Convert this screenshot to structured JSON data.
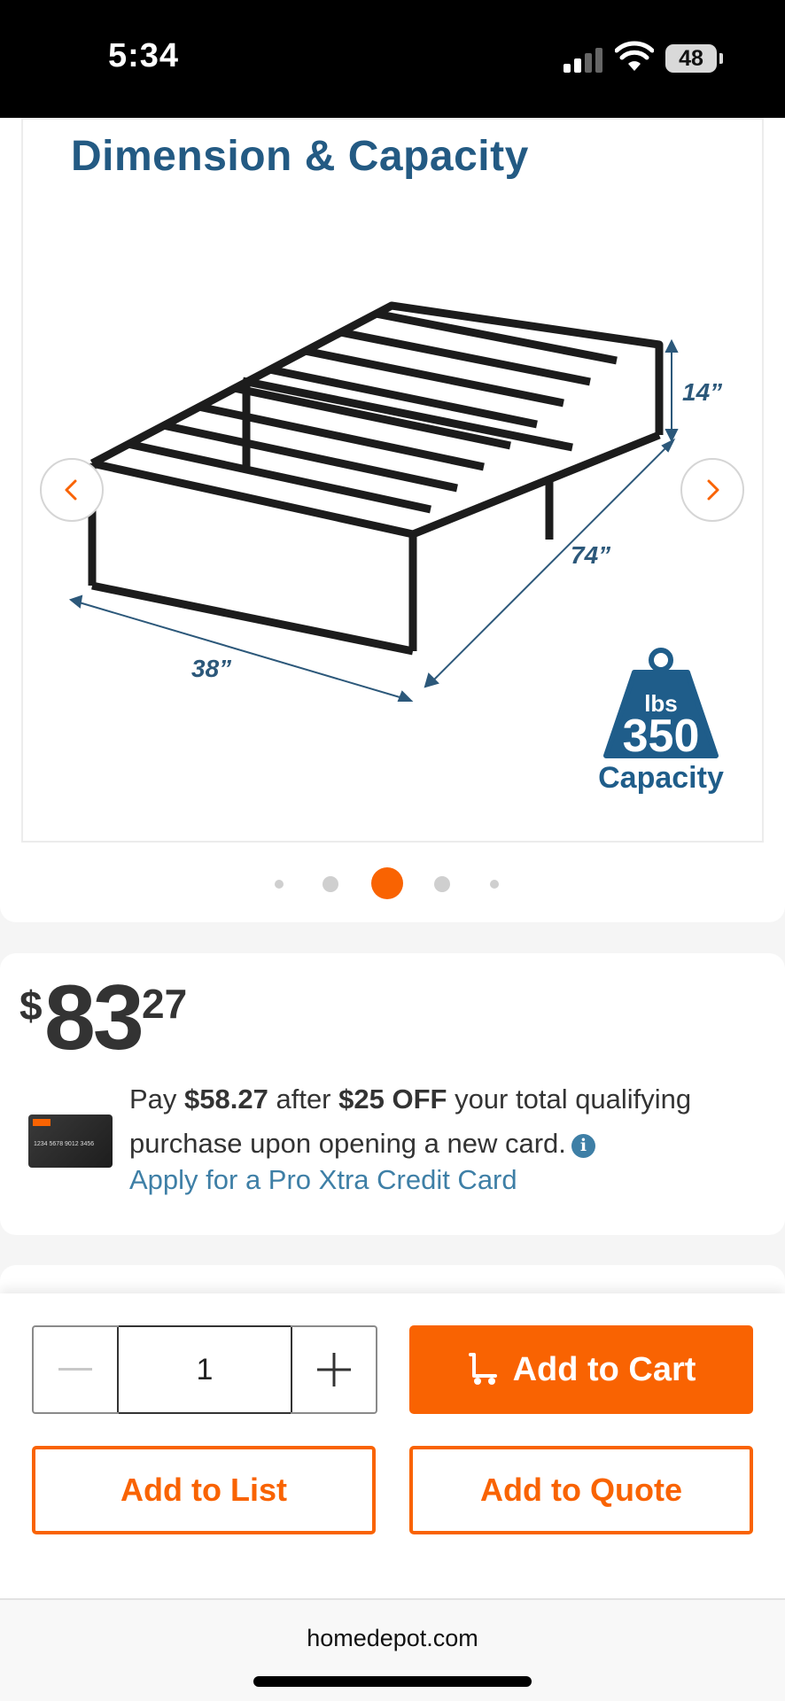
{
  "status_bar": {
    "time": "5:34",
    "battery": "48",
    "icons": [
      "signal-icon",
      "wifi-icon",
      "battery-icon"
    ]
  },
  "gallery": {
    "image_heading": "Dimension & Capacity",
    "dimensions": {
      "height": "14”",
      "length": "74”",
      "width": "38”"
    },
    "capacity": {
      "unit": "lbs",
      "value": "350",
      "label": "Capacity"
    },
    "dots_total": 5,
    "active_dot": 3,
    "icons": {
      "prev": "chevron-left-icon",
      "next": "chevron-right-icon"
    }
  },
  "price": {
    "symbol": "$",
    "dollars": "83",
    "cents": "27"
  },
  "promo": {
    "text_pre": "Pay ",
    "discount_price": "$58.27",
    "text_mid": " after ",
    "discount_amount": "$25 OFF",
    "text_post": " your total qualifying purchase upon opening a new card.",
    "link": "Apply for a Pro Xtra Credit Card",
    "card_number": "1234 5678 9012 3456"
  },
  "actions": {
    "quantity": "1",
    "add_to_cart": "Add to Cart",
    "add_to_list": "Add to List",
    "add_to_quote": "Add to Quote"
  },
  "browser": {
    "url": "homedepot.com"
  },
  "colors": {
    "accent": "#f96302",
    "link": "#3e7fa6",
    "heading": "#235a83"
  }
}
